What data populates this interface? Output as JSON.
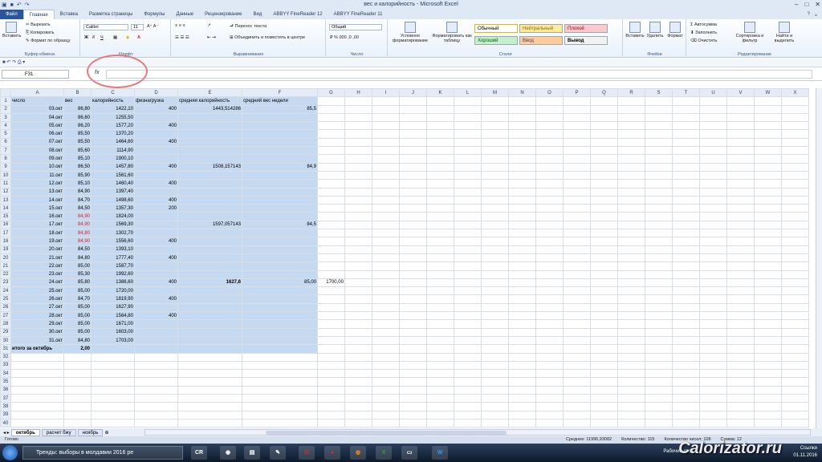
{
  "window": {
    "title": "вес и калорийность - Microsoft Excel"
  },
  "tabs": [
    "Файл",
    "Главная",
    "Вставка",
    "Разметка страницы",
    "Формулы",
    "Данные",
    "Рецензирование",
    "Вид",
    "ABBYY FineReader 12",
    "ABBYY FineReader 11"
  ],
  "ribbon": {
    "clipboard": {
      "label": "Буфер обмена",
      "paste": "Вставить",
      "cut": "Вырезать",
      "copy": "Копировать",
      "format": "Формат по образцу"
    },
    "font": {
      "label": "Шрифт",
      "name": "Calibri",
      "size": "11"
    },
    "align": {
      "label": "Выравнивание",
      "wrap": "Перенос текста",
      "merge": "Объединить и поместить в центре"
    },
    "number": {
      "label": "Число",
      "format": "Общий"
    },
    "styles": {
      "label": "Стили",
      "cond": "Условное форматирование",
      "table": "Форматировать как таблицу",
      "normal": "Обычный",
      "neutral": "Нейтральный",
      "bad": "Плохой",
      "good": "Хороший",
      "input": "Ввод",
      "output": "Вывод"
    },
    "cells": {
      "label": "Ячейки",
      "insert": "Вставить",
      "delete": "Удалить",
      "format": "Формат"
    },
    "editing": {
      "label": "Редактирование",
      "autosum": "Автосумма",
      "fill": "Заполнить",
      "clear": "Очистить",
      "sort": "Сортировка и фильтр",
      "find": "Найти и выделить"
    }
  },
  "formula_bar": {
    "cell": "F31",
    "fx": "fx",
    "value": ""
  },
  "columns": [
    "A",
    "B",
    "C",
    "D",
    "E",
    "F",
    "G",
    "H",
    "I",
    "J",
    "K",
    "L",
    "M",
    "N",
    "O",
    "P",
    "Q",
    "R",
    "S",
    "T",
    "U",
    "V",
    "W",
    "X"
  ],
  "rows": [
    {
      "n": "1",
      "a": "число",
      "b": "вес",
      "c": "калорийность",
      "d": "физнагрузка",
      "e": "средняя калорийность",
      "f": "средний вес недели",
      "g": ""
    },
    {
      "n": "2",
      "a": "03.окт",
      "b": "86,80",
      "c": "1422,10",
      "d": "400",
      "e": "1443,514286",
      "f": "85,5",
      "g": ""
    },
    {
      "n": "3",
      "a": "04.окт",
      "b": "86,60",
      "c": "1255,50",
      "d": "",
      "e": "",
      "f": "",
      "g": ""
    },
    {
      "n": "4",
      "a": "05.окт",
      "b": "86,20",
      "c": "1577,20",
      "d": "400",
      "e": "",
      "f": "",
      "g": ""
    },
    {
      "n": "5",
      "a": "06.окт",
      "b": "85,50",
      "c": "1370,20",
      "d": "",
      "e": "",
      "f": "",
      "g": ""
    },
    {
      "n": "6",
      "a": "07.окт",
      "b": "85,50",
      "c": "1464,60",
      "d": "400",
      "e": "",
      "f": "",
      "g": ""
    },
    {
      "n": "7",
      "a": "08.окт",
      "b": "85,60",
      "c": "1114,90",
      "d": "",
      "e": "",
      "f": "",
      "g": ""
    },
    {
      "n": "8",
      "a": "09.окт",
      "b": "85,10",
      "c": "1900,10",
      "d": "",
      "e": "",
      "f": "",
      "g": ""
    },
    {
      "n": "9",
      "a": "10.окт",
      "b": "86,50",
      "c": "1457,80",
      "d": "400",
      "e": "1508,157143",
      "f": "84,9",
      "g": ""
    },
    {
      "n": "10",
      "a": "11.окт",
      "b": "85,90",
      "c": "1561,60",
      "d": "",
      "e": "",
      "f": "",
      "g": ""
    },
    {
      "n": "11",
      "a": "12.окт",
      "b": "85,10",
      "c": "1460,40",
      "d": "400",
      "e": "",
      "f": "",
      "g": ""
    },
    {
      "n": "12",
      "a": "13.окт",
      "b": "84,90",
      "c": "1397,40",
      "d": "",
      "e": "",
      "f": "",
      "g": ""
    },
    {
      "n": "13",
      "a": "14.окт",
      "b": "84,70",
      "c": "1498,60",
      "d": "400",
      "e": "",
      "f": "",
      "g": ""
    },
    {
      "n": "14",
      "a": "15.окт",
      "b": "84,50",
      "c": "1357,30",
      "d": "200",
      "e": "",
      "f": "",
      "g": ""
    },
    {
      "n": "15",
      "a": "16.окт",
      "b": "84,90",
      "c": "1824,00",
      "d": "",
      "e": "",
      "f": "",
      "g": "",
      "red": true
    },
    {
      "n": "16",
      "a": "17.окт",
      "b": "84,90",
      "c": "1569,30",
      "d": "",
      "e": "1597,057143",
      "f": "84,5",
      "g": "",
      "red": true
    },
    {
      "n": "17",
      "a": "18.окт",
      "b": "84,80",
      "c": "1302,70",
      "d": "",
      "e": "",
      "f": "",
      "g": "",
      "red": true
    },
    {
      "n": "18",
      "a": "19.окт",
      "b": "84,90",
      "c": "1556,60",
      "d": "400",
      "e": "",
      "f": "",
      "g": "",
      "red": true
    },
    {
      "n": "19",
      "a": "20.окт",
      "b": "84,50",
      "c": "1393,10",
      "d": "",
      "e": "",
      "f": "",
      "g": ""
    },
    {
      "n": "20",
      "a": "21.окт",
      "b": "84,80",
      "c": "1777,40",
      "d": "400",
      "e": "",
      "f": "",
      "g": ""
    },
    {
      "n": "21",
      "a": "22.окт",
      "b": "85,00",
      "c": "1587,70",
      "d": "",
      "e": "",
      "f": "",
      "g": ""
    },
    {
      "n": "22",
      "a": "23.окт",
      "b": "85,30",
      "c": "1992,60",
      "d": "",
      "e": "",
      "f": "",
      "g": ""
    },
    {
      "n": "23",
      "a": "24.окт",
      "b": "85,80",
      "c": "1386,60",
      "d": "400",
      "e": "1627,6",
      "f": "85,00",
      "g": "1700,00",
      "boldE": true
    },
    {
      "n": "24",
      "a": "25.окт",
      "b": "85,00",
      "c": "1720,00",
      "d": "",
      "e": "",
      "f": "",
      "g": ""
    },
    {
      "n": "25",
      "a": "26.окт",
      "b": "84,70",
      "c": "1819,90",
      "d": "400",
      "e": "",
      "f": "",
      "g": ""
    },
    {
      "n": "26",
      "a": "27.окт",
      "b": "85,00",
      "c": "1627,90",
      "d": "",
      "e": "",
      "f": "",
      "g": ""
    },
    {
      "n": "27",
      "a": "28.окт",
      "b": "85,00",
      "c": "1564,80",
      "d": "400",
      "e": "",
      "f": "",
      "g": ""
    },
    {
      "n": "28",
      "a": "29.окт",
      "b": "85,00",
      "c": "1671,00",
      "d": "",
      "e": "",
      "f": "",
      "g": ""
    },
    {
      "n": "29",
      "a": "30.окт",
      "b": "85,00",
      "c": "1603,00",
      "d": "",
      "e": "",
      "f": "",
      "g": ""
    },
    {
      "n": "30",
      "a": "31.окт",
      "b": "84,80",
      "c": "1703,00",
      "d": "",
      "e": "",
      "f": "",
      "g": ""
    },
    {
      "n": "31",
      "a": "итого за октябрь",
      "b": "2,00",
      "c": "",
      "d": "",
      "e": "",
      "f": "",
      "g": "",
      "bold": true
    },
    {
      "n": "32"
    },
    {
      "n": "33"
    },
    {
      "n": "34"
    },
    {
      "n": "35"
    },
    {
      "n": "36"
    },
    {
      "n": "37"
    },
    {
      "n": "38"
    },
    {
      "n": "39"
    },
    {
      "n": "40"
    }
  ],
  "sheets": [
    "октябрь",
    "расчет бжу",
    "ноябрь"
  ],
  "status": {
    "ready": "Готово",
    "avg": "Среднее: 11996,93082",
    "count": "Количество: 115",
    "numcount": "Количество чисел: 108",
    "sum": "Сумма: 12"
  },
  "taskbar": {
    "item": "Тренды: выборы в молдавии 2016 ре",
    "desktop": "Рабочий стол",
    "links": "Ссылки",
    "date": "01.11.2016"
  },
  "watermark": "Calorizator.ru"
}
